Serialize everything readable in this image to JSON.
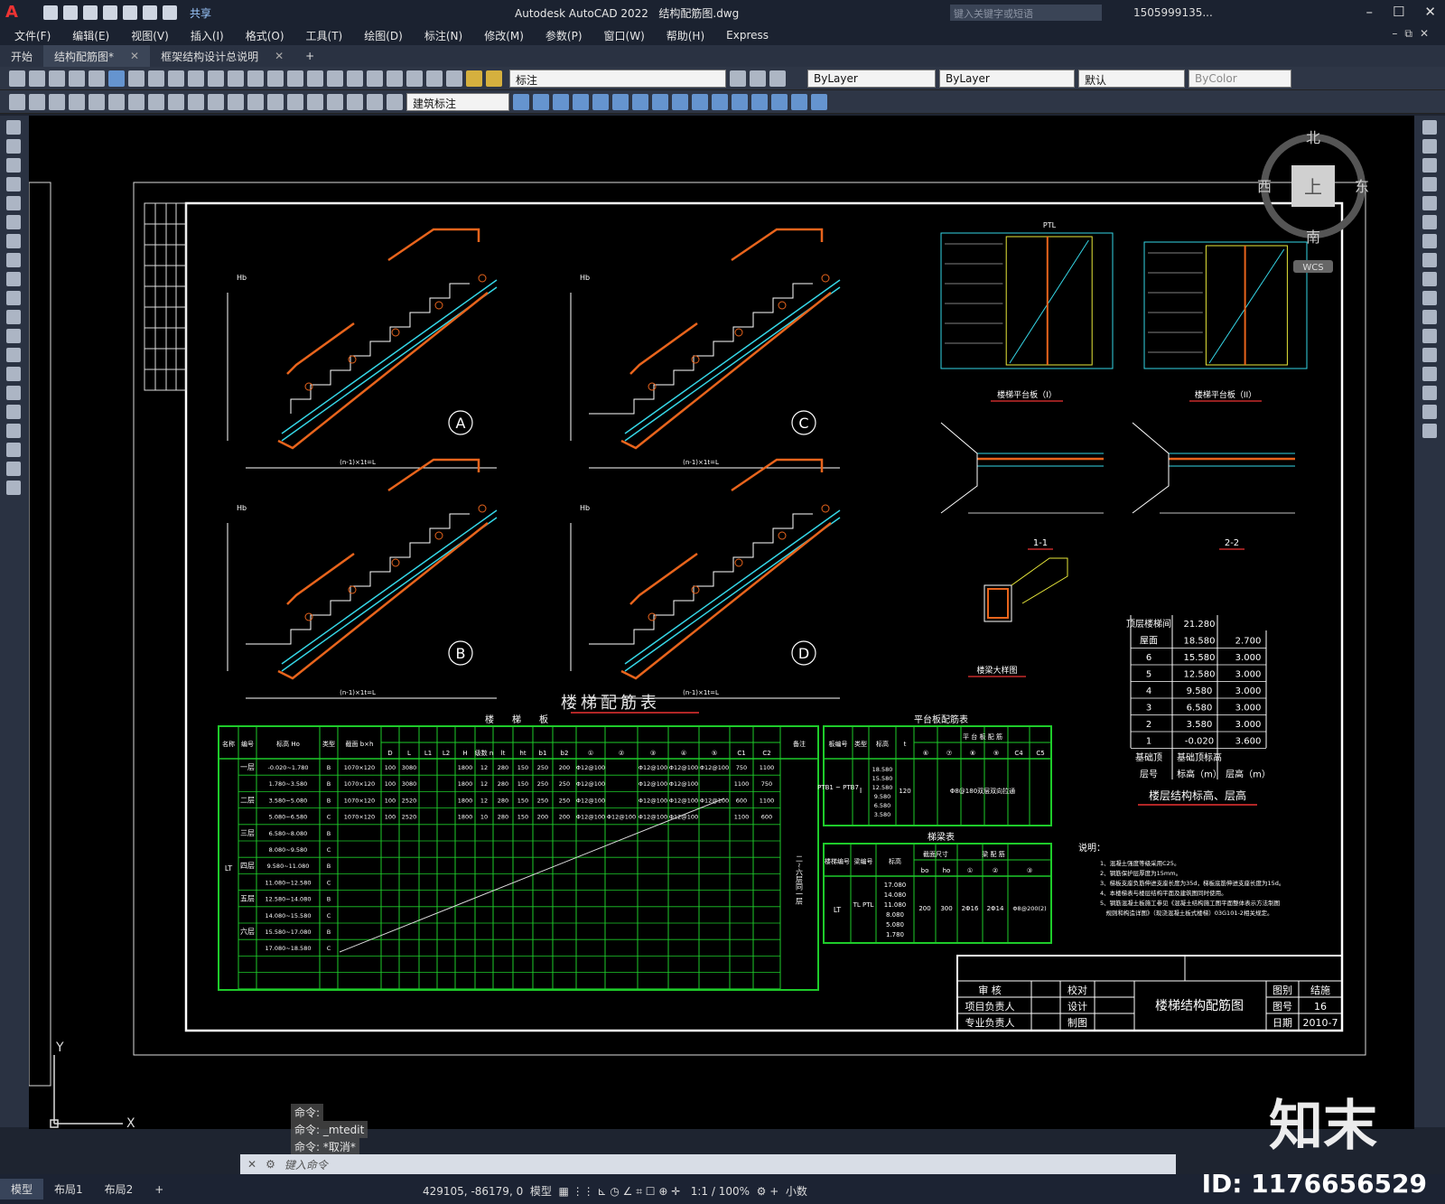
{
  "app": {
    "logo": "A",
    "title": "Autodesk AutoCAD 2022",
    "file": "结构配筋图.dwg",
    "share": "共享",
    "search_placeholder": "键入关键字或短语",
    "user": "1505999135...",
    "watermark_id": "ID: 1176656529",
    "wm_logo": "知末"
  },
  "menu": [
    "文件(F)",
    "编辑(E)",
    "视图(V)",
    "插入(I)",
    "格式(O)",
    "工具(T)",
    "绘图(D)",
    "标注(N)",
    "修改(M)",
    "参数(P)",
    "窗口(W)",
    "帮助(H)",
    "Express"
  ],
  "tabs": [
    "开始",
    "结构配筋图*",
    "框架结构设计总说明"
  ],
  "toolbar": {
    "layer": "标注",
    "color": "ByLayer",
    "linetype": "ByLayer",
    "lineweight": "默认",
    "plot": "ByColor",
    "dimstyle": "建筑标注"
  },
  "viewcube": {
    "n": "北",
    "s": "南",
    "e": "东",
    "w": "西",
    "top": "上",
    "wcs": "WCS"
  },
  "drawing": {
    "labels": {
      "A": "A",
      "B": "B",
      "C": "C",
      "D": "D",
      "hb": "Hb",
      "span": "(n-1)×1t=L",
      "pl1": "楼梯平台板（I）",
      "pl2": "楼梯平台板（II）",
      "s11": "1-1",
      "s22": "2-2",
      "beam": "楼梁大样图",
      "ptl": "PTL"
    },
    "table_title": "楼梯配筋表",
    "table_sub": "楼　　梯　　板",
    "stair_headers": [
      "名称",
      "编号",
      "标高 Ho",
      "类型",
      "截面 b×h",
      "D",
      "L",
      "L1",
      "L2",
      "H",
      "级数 n",
      "lt",
      "ht",
      "b1",
      "b2",
      "①",
      "②",
      "③",
      "④",
      "⑤",
      "C1",
      "C2",
      "备注"
    ],
    "stair_rows": [
      [
        "一层",
        "-0.020~1.780",
        "B",
        "1070×120",
        "100",
        "3080",
        "",
        "",
        "1800",
        "12",
        "280",
        "150",
        "250",
        "200",
        "Φ12@100",
        "",
        "Φ12@100",
        "Φ12@100",
        "Φ12@100",
        "750",
        "1100"
      ],
      [
        "",
        "1.780~3.580",
        "B",
        "1070×120",
        "100",
        "3080",
        "",
        "",
        "1800",
        "12",
        "280",
        "150",
        "250",
        "250",
        "Φ12@100",
        "",
        "Φ12@100",
        "Φ12@100",
        "",
        "1100",
        "750"
      ],
      [
        "二层",
        "3.580~5.080",
        "B",
        "1070×120",
        "100",
        "2520",
        "",
        "",
        "1800",
        "12",
        "280",
        "150",
        "250",
        "250",
        "Φ12@100",
        "",
        "Φ12@100",
        "Φ12@100",
        "Φ12@100",
        "600",
        "1100"
      ],
      [
        "",
        "5.080~6.580",
        "C",
        "1070×120",
        "100",
        "2520",
        "",
        "",
        "1800",
        "10",
        "280",
        "150",
        "200",
        "200",
        "Φ12@100",
        "Φ12@100",
        "Φ12@100",
        "Φ12@100",
        "",
        "1100",
        "600"
      ],
      [
        "三层",
        "6.580~8.080",
        "B"
      ],
      [
        "",
        "8.080~9.580",
        "C"
      ],
      [
        "四层",
        "9.580~11.080",
        "B"
      ],
      [
        "",
        "11.080~12.580",
        "C"
      ],
      [
        "五层",
        "12.580~14.080",
        "B"
      ],
      [
        "",
        "14.080~15.580",
        "C"
      ],
      [
        "六层",
        "15.580~17.080",
        "B"
      ],
      [
        "",
        "17.080~18.580",
        "C"
      ]
    ],
    "stair_note": "二~六层同一层",
    "lt": "LT",
    "plat_title": "平台板配筋表",
    "plat_headers": [
      "板编号",
      "类型",
      "标高",
      "t",
      "⑥",
      "⑦",
      "⑧",
      "⑨",
      "C4",
      "C5"
    ],
    "plat_sub": "平 台 板 配 筋",
    "plat_row": {
      "id": "PTB1 ~ PTB7",
      "type": "I",
      "elev": [
        "18.580",
        "15.580",
        "12.580",
        "9.580",
        "6.580",
        "3.580"
      ],
      "t": "120",
      "note": "Φ8@180双层双向拉通"
    },
    "beam_title": "梯梁表",
    "beam_headers": [
      "楼梯编号",
      "梁编号",
      "标高",
      "bo",
      "ho",
      "①",
      "②",
      "③"
    ],
    "beam_sub1": "截面尺寸",
    "beam_sub2": "梁 配 筋",
    "beam_row": {
      "id": "LT",
      "beams": "TL PTL",
      "elev": [
        "17.080",
        "14.080",
        "11.080",
        "8.080",
        "5.080",
        "1.780"
      ],
      "bo": "200",
      "ho": "300",
      "r1": "2Φ16",
      "r2": "2Φ14",
      "r3": "Φ8@200(2)"
    },
    "level_rows": [
      [
        "顶层楼梯间",
        "21.280",
        ""
      ],
      [
        "屋面",
        "18.580",
        "2.700"
      ],
      [
        "6",
        "15.580",
        "3.000"
      ],
      [
        "5",
        "12.580",
        "3.000"
      ],
      [
        "4",
        "9.580",
        "3.000"
      ],
      [
        "3",
        "6.580",
        "3.000"
      ],
      [
        "2",
        "3.580",
        "3.000"
      ],
      [
        "1",
        "-0.020",
        "3.600"
      ],
      [
        "基础顶",
        "基础顶标高",
        ""
      ],
      [
        "层号",
        "标高（m）",
        "层高（m）"
      ]
    ],
    "level_title": "楼层结构标高、层高",
    "notes_title": "说明：",
    "notes": [
      "1、混凝土强度等级采用C25。",
      "2、钢筋保护层厚度为15mm。",
      "3、梯板支座负筋伸进支座长度为35d，梯板底筋伸进支座长度为15d。",
      "4、本楼梯表与楼层结构平面及建筑图同时使用。",
      "5、钢筋混凝土板施工参见《混凝土结构施工图平面整体表示方法制图",
      "　规则和构造详图》（现浇混凝土板式楼梯）03G101-2相关规定。"
    ],
    "titleblock": {
      "r1": [
        "审 核",
        "校对"
      ],
      "r2": [
        "项目负责人",
        "设计"
      ],
      "r3": [
        "专业负责人",
        "制图"
      ],
      "name": "楼梯结构配筋图",
      "k1": "图别",
      "v1": "结施",
      "k2": "图号",
      "v2": "16",
      "k3": "日期",
      "v3": "2010-7"
    }
  },
  "commands": [
    "命令:",
    "命令: _mtedit",
    "命令: *取消*"
  ],
  "cmd_placeholder": "键入命令",
  "layout_tabs": [
    "模型",
    "布局1",
    "布局2"
  ],
  "coords": "429105, -86179, 0",
  "status": {
    "model": "模型",
    "scale": "1:1 / 100%",
    "units": "小数"
  }
}
